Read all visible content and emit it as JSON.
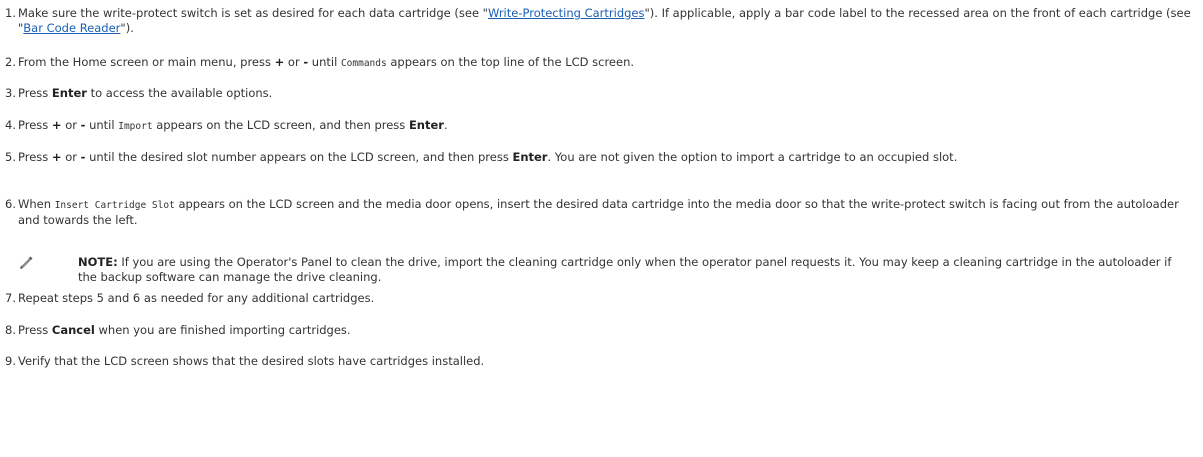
{
  "steps": [
    {
      "num": "1.",
      "before": "Make sure the write-protect switch is set as desired for each data cartridge (see \"",
      "link1": "Write-Protecting Cartridges",
      "middle": "\"). If applicable, apply a bar code label to the recessed area on the front of each cartridge (see \"",
      "link2": "Bar Code Reader",
      "after": "\")."
    },
    {
      "num": "2.",
      "before": "From the Home screen or main menu, press ",
      "plus": "+",
      "or": " or ",
      "minus": "-",
      "until": " until ",
      "code": "Commands",
      "after": " appears on the top line of the LCD screen."
    },
    {
      "num": "3.",
      "before": "Press ",
      "bold": "Enter",
      "after": " to access the available options."
    },
    {
      "num": "4.",
      "before": "Press ",
      "plus": "+",
      "or": " or ",
      "minus": "-",
      "until": " until ",
      "code": "Import",
      "middle": " appears on the LCD screen, and then press ",
      "bold": "Enter",
      "after": "."
    },
    {
      "num": "5.",
      "before": "Press ",
      "plus": "+",
      "or": " or ",
      "minus": "-",
      "middle": " until the desired slot number appears on the LCD screen, and then press ",
      "bold": "Enter",
      "after": ". You are not given the option to import a cartridge to an occupied slot."
    },
    {
      "num": "6.",
      "before": "When ",
      "code": "Insert Cartridge Slot",
      "after": " appears on the LCD screen and the media door opens, insert the desired data cartridge into the media door so that the write-protect switch is facing out from the autoloader and towards the left."
    },
    {
      "num": "7.",
      "text": "Repeat steps 5 and 6 as needed for any additional cartridges."
    },
    {
      "num": "8.",
      "before": "Press ",
      "bold": "Cancel",
      "after": " when you are finished importing cartridges."
    },
    {
      "num": "9.",
      "text": "Verify that the LCD screen shows that the desired slots have cartridges installed."
    }
  ],
  "note": {
    "label": "NOTE:",
    "text": " If you are using the Operator's Panel to clean the drive, import the cleaning cartridge only when the operator panel requests it. You may keep a cleaning cartridge in the autoloader if the backup software can manage the drive cleaning.",
    "icon": "pencil-icon"
  },
  "colors": {
    "text": "#333333",
    "link": "#1a5fb4"
  }
}
